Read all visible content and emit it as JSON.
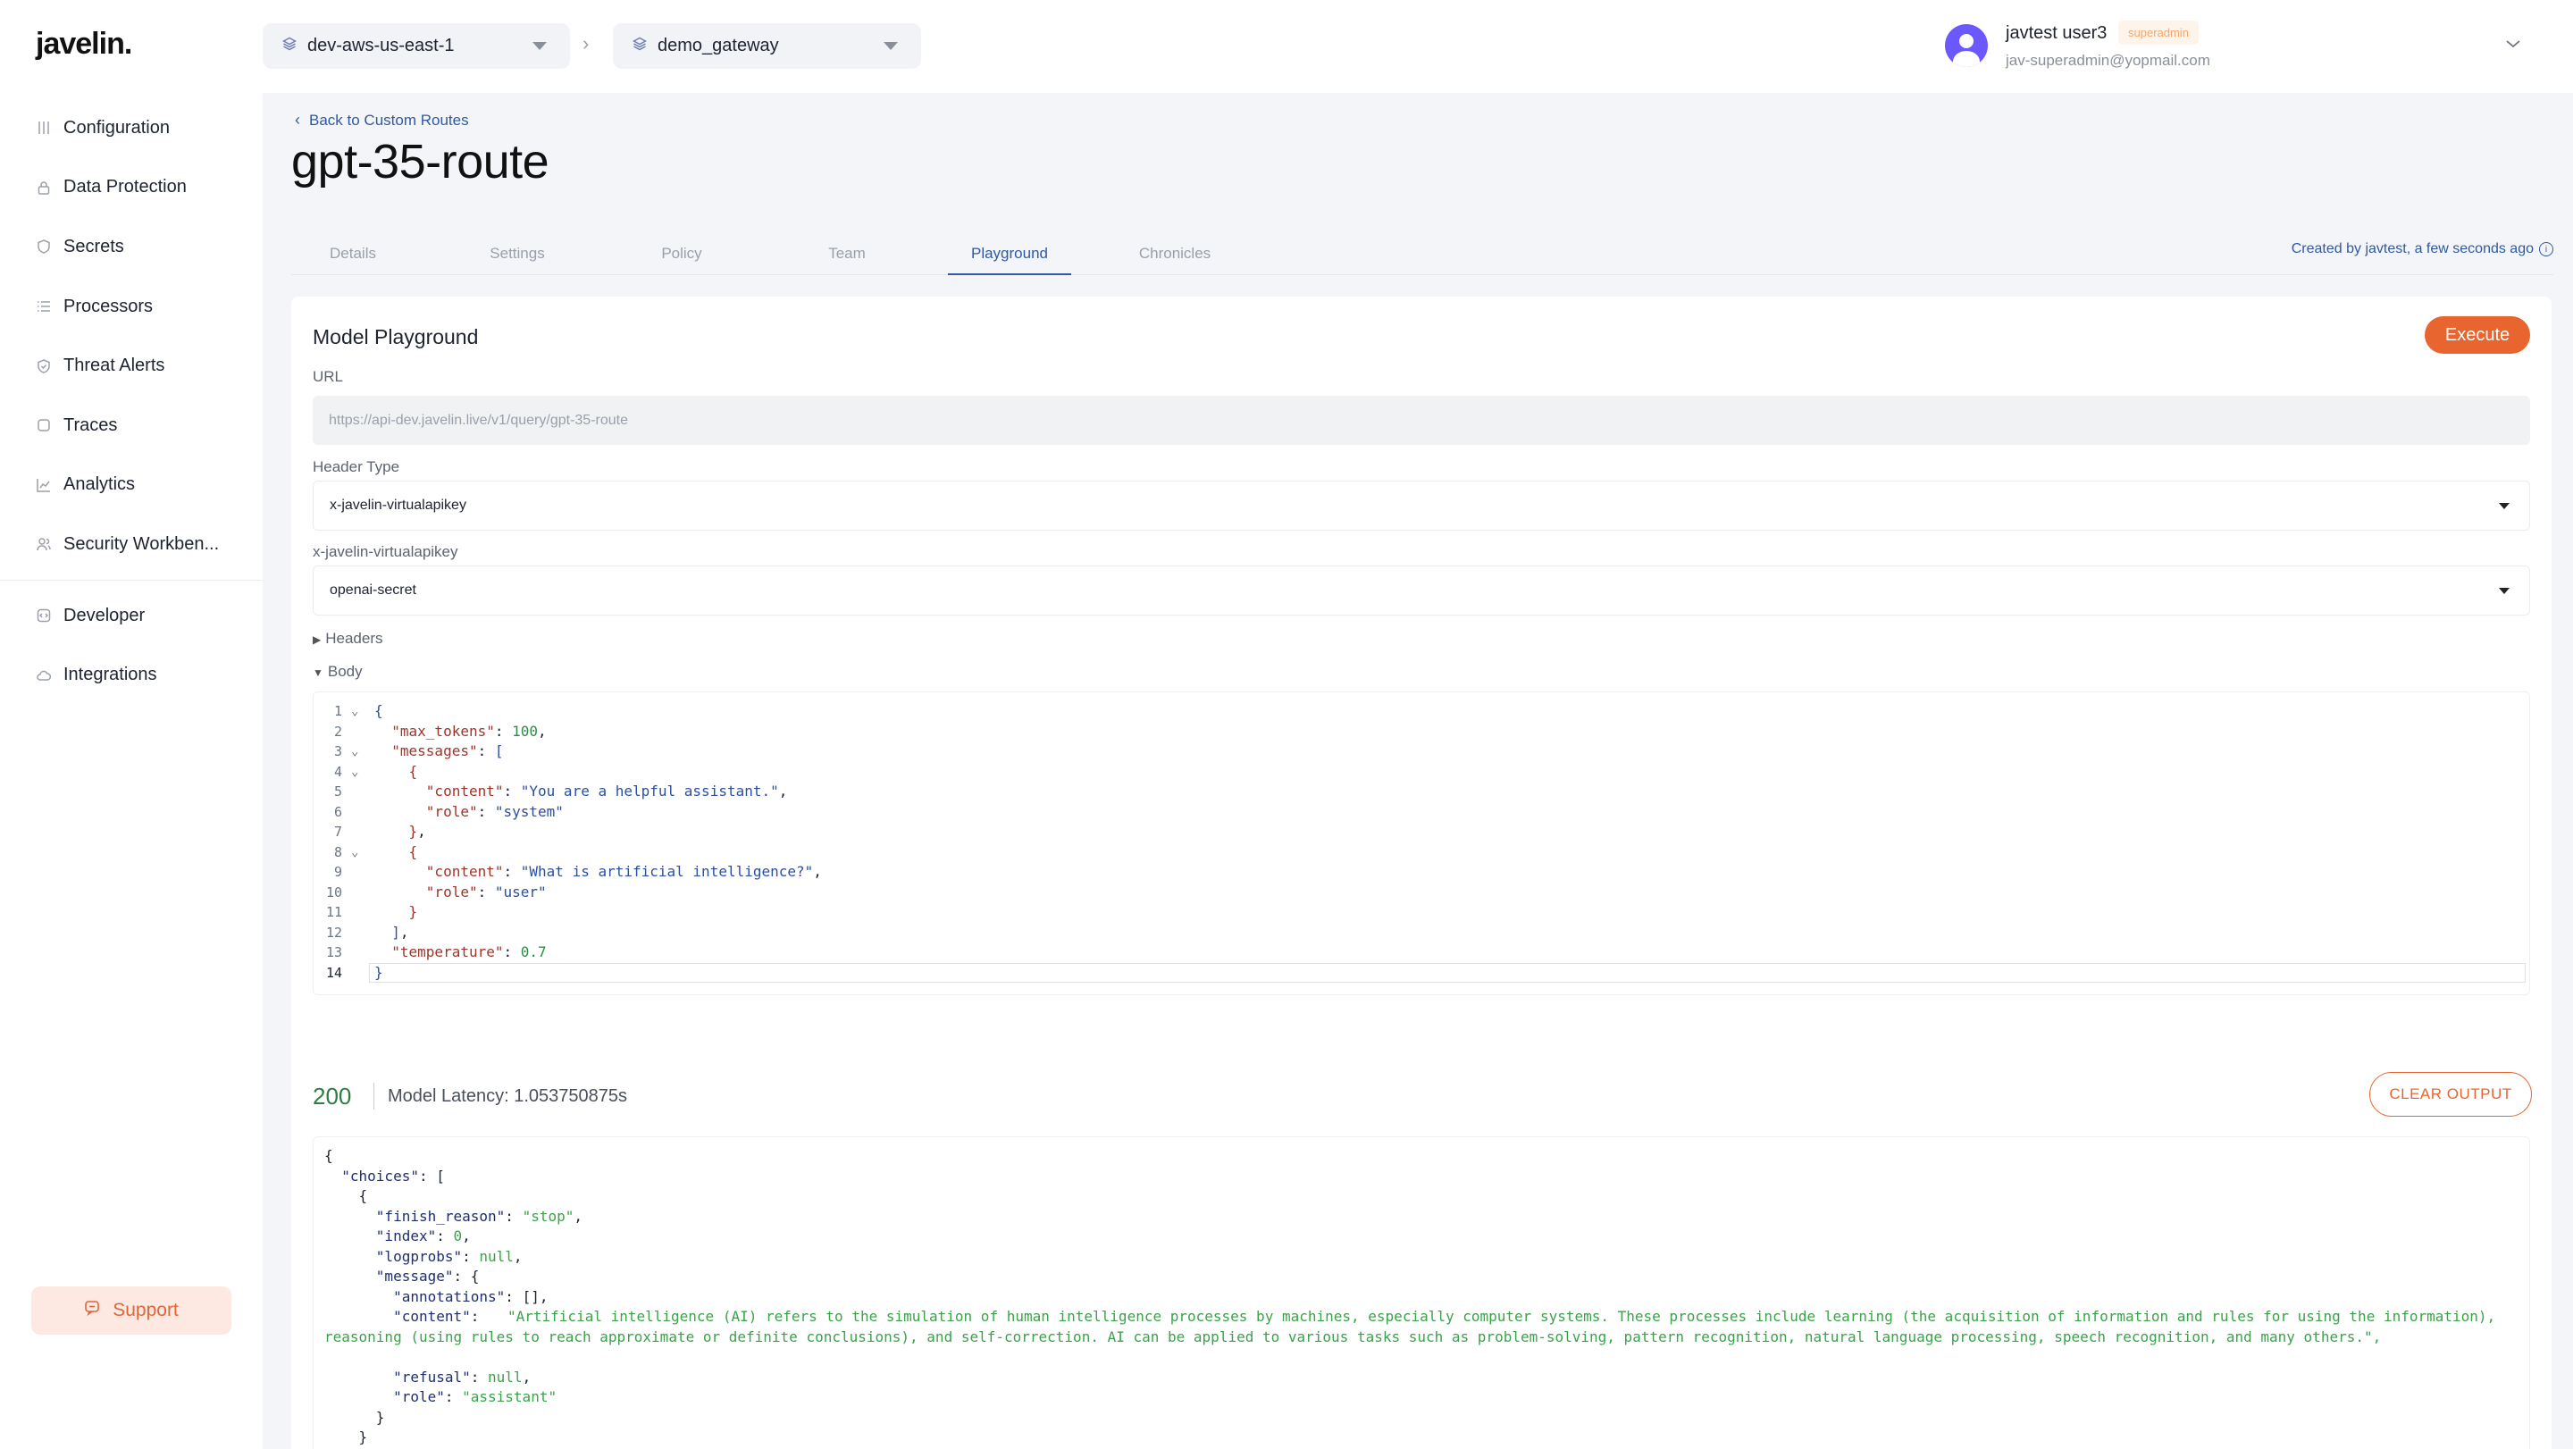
{
  "brand": {
    "logo": "javelin."
  },
  "sidebar": {
    "items": [
      {
        "label": "Configuration",
        "icon": "sliders-icon"
      },
      {
        "label": "Data Protection",
        "icon": "lock-icon"
      },
      {
        "label": "Secrets",
        "icon": "shield-icon"
      },
      {
        "label": "Processors",
        "icon": "list-icon"
      },
      {
        "label": "Threat Alerts",
        "icon": "shield-check-icon"
      },
      {
        "label": "Traces",
        "icon": "square-icon"
      },
      {
        "label": "Analytics",
        "icon": "chart-line-icon"
      },
      {
        "label": "Security Workben...",
        "icon": "users-icon"
      }
    ],
    "secondary": [
      {
        "label": "Developer",
        "icon": "code-icon"
      },
      {
        "label": "Integrations",
        "icon": "cloud-icon"
      }
    ],
    "support_label": "Support"
  },
  "topbar": {
    "environment": "dev-aws-us-east-1",
    "gateway": "demo_gateway",
    "user": {
      "name": "javtest user3",
      "role": "superadmin",
      "email": "jav-superadmin@yopmail.com"
    }
  },
  "page": {
    "back_label": "Back to Custom Routes",
    "title": "gpt-35-route",
    "tabs": [
      "Details",
      "Settings",
      "Policy",
      "Team",
      "Playground",
      "Chronicles"
    ],
    "active_tab": "Playground",
    "created_text": "Created by javtest, a few seconds ago"
  },
  "playground": {
    "title": "Model Playground",
    "execute_label": "Execute",
    "url_label": "URL",
    "url_value": "https://api-dev.javelin.live/v1/query/gpt-35-route",
    "header_type_label": "Header Type",
    "header_type_value": "x-javelin-virtualapikey",
    "apikey_label": "x-javelin-virtualapikey",
    "apikey_value": "openai-secret",
    "headers_toggle": "Headers",
    "body_toggle": "Body"
  },
  "body_code": [
    "{",
    "  \"max_tokens\": 100,",
    "  \"messages\": [",
    "    {",
    "      \"content\": \"You are a helpful assistant.\",",
    "      \"role\": \"system\"",
    "    },",
    "    {",
    "      \"content\": \"What is artificial intelligence?\",",
    "      \"role\": \"user\"",
    "    }",
    "  ],",
    "  \"temperature\": 0.7",
    "}"
  ],
  "response": {
    "status": "200",
    "latency": "Model Latency: 1.053750875s",
    "clear_label": "CLEAR OUTPUT",
    "content": "\"Artificial intelligence (AI) refers to the simulation of human intelligence processes by machines, especially computer systems. These processes include learning (the acquisition of information and rules for using the information), reasoning (using rules to reach approximate or definite conclusions), and self-correction. AI can be applied to various tasks such as problem-solving, pattern recognition, natural language processing, speech recognition, and many others.\","
  }
}
